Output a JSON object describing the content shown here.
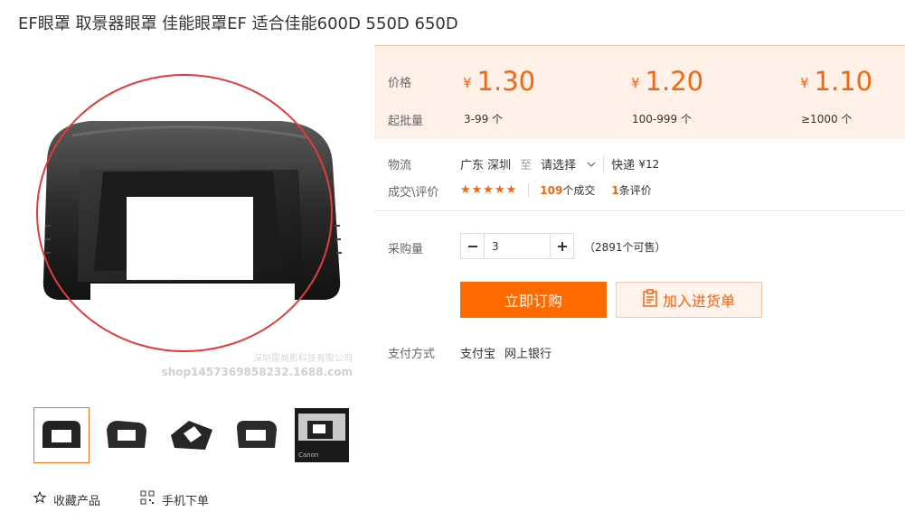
{
  "product": {
    "title": "EF眼罩 取景器眼罩 佳能眼罩EF 适合佳能600D 550D 650D"
  },
  "image": {
    "watermark_line1": "深圳霆尚影科技有限公司",
    "watermark_line2": "shop1457369858232.1688.com"
  },
  "thumbnails": [
    {
      "name": "eyecup-front",
      "active": true
    },
    {
      "name": "eyecup-angle"
    },
    {
      "name": "eyecup-tilted"
    },
    {
      "name": "eyecup-side"
    },
    {
      "name": "camera-mounted"
    }
  ],
  "bottom_actions": {
    "favorite": "收藏产品",
    "mobile_order": "手机下单"
  },
  "pricing": {
    "price_label": "价格",
    "moq_label": "起批量",
    "currency": "¥",
    "tiers": [
      {
        "price": "1.30",
        "range": "3-99 个"
      },
      {
        "price": "1.20",
        "range": "100-999 个"
      },
      {
        "price": "1.10",
        "range": "≥1000 个"
      }
    ]
  },
  "logistics": {
    "label": "物流",
    "origin": "广东 深圳",
    "to": "至",
    "destination": "请选择",
    "method": "快递",
    "fee": "¥12"
  },
  "reviews": {
    "label": "成交\\评价",
    "stars": "★★★★★",
    "deals_count": "109",
    "deals_suffix": "个成交",
    "review_count": "1",
    "review_suffix": "条评价"
  },
  "quantity": {
    "label": "采购量",
    "value": "3",
    "stock": "（2891个可售）"
  },
  "actions": {
    "buy_now": "立即订购",
    "add_to_list": "加入进货单"
  },
  "payment": {
    "label": "支付方式",
    "methods": [
      "支付宝",
      "网上银行"
    ]
  },
  "colors": {
    "accent": "#ff6a00",
    "price": "#f26513",
    "price_bg": "#fff1e8"
  }
}
